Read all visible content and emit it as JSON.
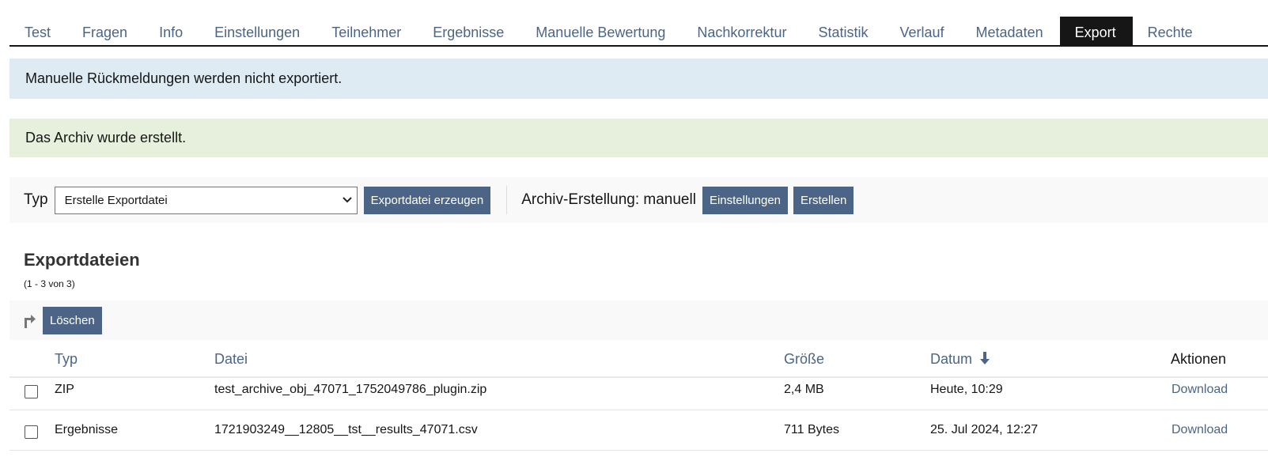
{
  "tabs": [
    "Test",
    "Fragen",
    "Info",
    "Einstellungen",
    "Teilnehmer",
    "Ergebnisse",
    "Manuelle Bewertung",
    "Nachkorrektur",
    "Statistik",
    "Verlauf",
    "Metadaten",
    "Export",
    "Rechte"
  ],
  "active_tab": "Export",
  "messages": {
    "info": "Manuelle Rückmeldungen werden nicht exportiert.",
    "success": "Das Archiv wurde erstellt."
  },
  "toolbar": {
    "type_label": "Typ",
    "type_select_value": "Erstelle Exportdatei",
    "create_export_button": "Exportdatei erzeugen",
    "archive_label": "Archiv-Erstellung: manuell",
    "settings_button": "Einstellungen",
    "create_button": "Erstellen"
  },
  "export_files": {
    "title": "Exportdateien",
    "count": "(1 - 3 von 3)",
    "delete_button": "Löschen",
    "columns": {
      "type": "Typ",
      "file": "Datei",
      "size": "Größe",
      "date": "Datum",
      "actions": "Aktionen"
    },
    "sort_indicator": "descending",
    "rows": [
      {
        "type": "ZIP",
        "file": "test_archive_obj_47071_1752049786_plugin.zip",
        "size": "2,4 MB",
        "date": "Heute, 10:29",
        "action": "Download"
      },
      {
        "type": "Ergebnisse",
        "file": "1721903249__12805__tst__results_47071.csv",
        "size": "711 Bytes",
        "date": "25. Jul 2024, 12:27",
        "action": "Download"
      }
    ]
  },
  "colors": {
    "accent": "#4c6586",
    "tab_active_bg": "#161616",
    "info_bg": "#deebf3",
    "success_bg": "#e6f0dc"
  }
}
